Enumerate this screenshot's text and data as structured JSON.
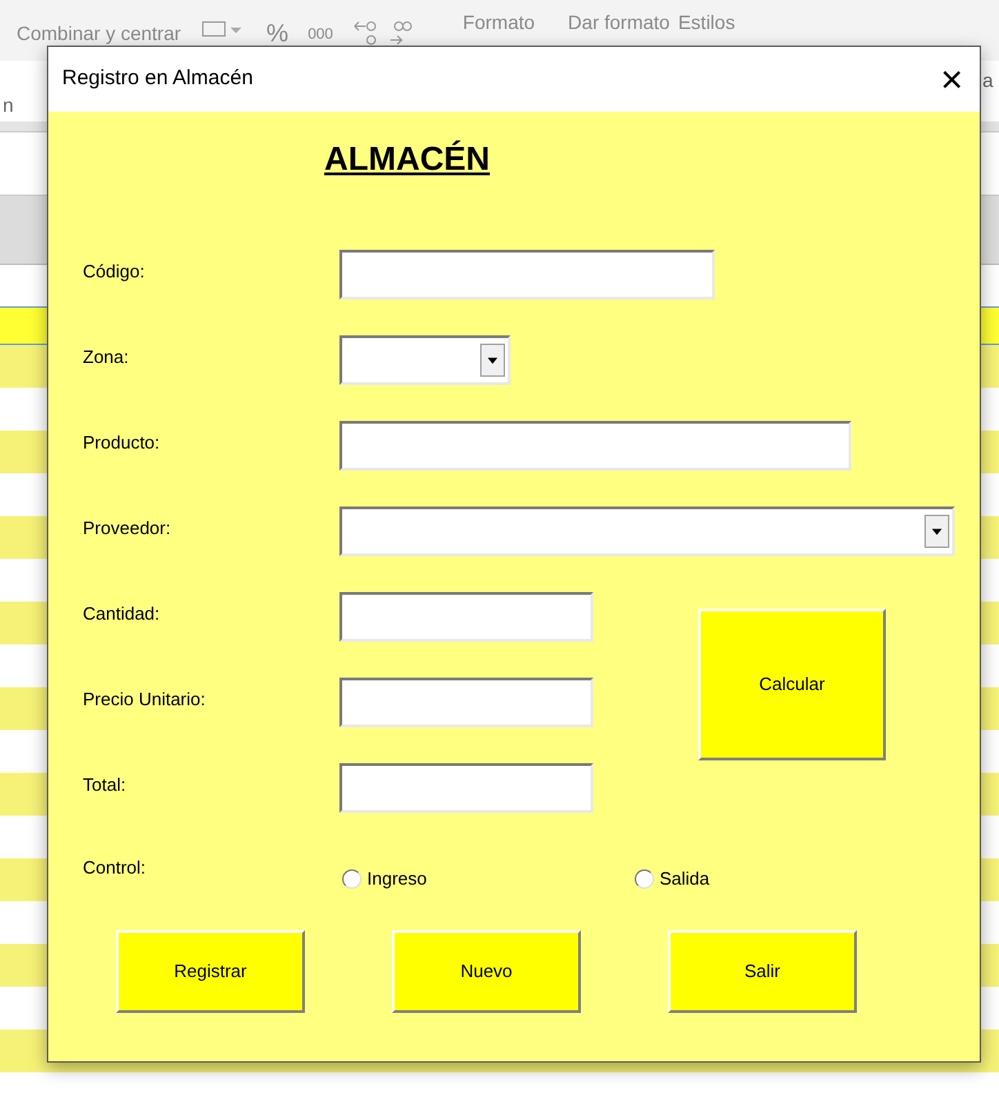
{
  "ribbon": {
    "merge_label": "Combinar y centrar",
    "percent": "%",
    "thousands": "000",
    "format": "Formato",
    "format_as": "Dar formato",
    "styles": "Estilos",
    "left_fragment": "n",
    "right_fragment": "a"
  },
  "window": {
    "title": "Registro en Almacén",
    "close": "×"
  },
  "heading": "ALMACÉN",
  "fields": [
    {
      "label": "Código:",
      "kind": "text"
    },
    {
      "label": "Zona:",
      "kind": "combo"
    },
    {
      "label": "Producto:",
      "kind": "text"
    },
    {
      "label": "Proveedor:",
      "kind": "combo"
    },
    {
      "label": "Cantidad:",
      "kind": "text"
    },
    {
      "label": "Precio Unitario:",
      "kind": "text"
    },
    {
      "label": "Total:",
      "kind": "text"
    }
  ],
  "calculate_button": "Calcular",
  "control": {
    "label": "Control:",
    "options": [
      {
        "label": "Ingreso",
        "selected": false
      },
      {
        "label": "Salida",
        "selected": false
      }
    ]
  },
  "buttons": [
    "Registrar",
    "Nuevo",
    "Salir"
  ]
}
